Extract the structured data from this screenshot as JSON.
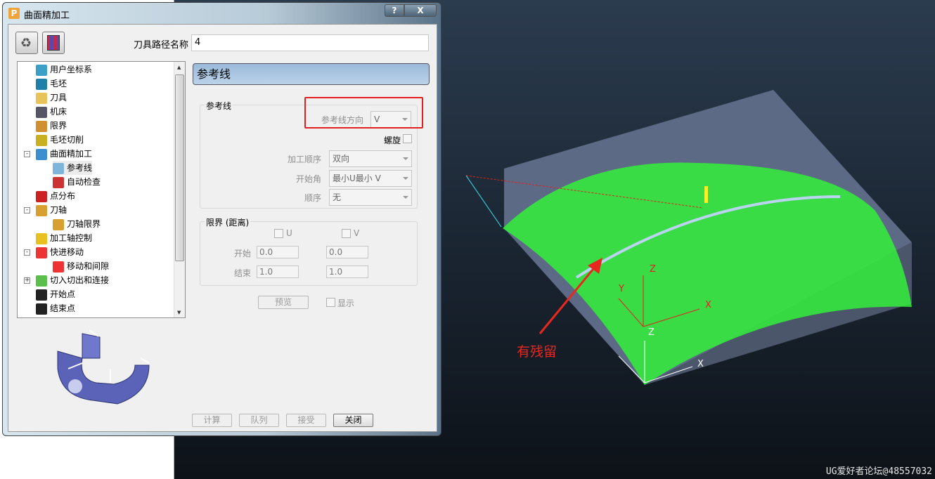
{
  "window": {
    "title": "曲面精加工",
    "help": "?",
    "close": "X",
    "app_icon": "P"
  },
  "toolbar": {
    "icons": [
      "recycle-icon",
      "toolpath-preview-icon"
    ]
  },
  "toolpath_name": {
    "label": "刀具路径名称",
    "value": "4"
  },
  "tree": {
    "items": [
      {
        "label": "用户坐标系",
        "icon": "user-coordinate-icon",
        "level": 0
      },
      {
        "label": "毛坯",
        "icon": "block-icon",
        "level": 0
      },
      {
        "label": "刀具",
        "icon": "tool-icon",
        "level": 0
      },
      {
        "label": "机床",
        "icon": "machine-icon",
        "level": 0
      },
      {
        "label": "限界",
        "icon": "limits-icon",
        "level": 0
      },
      {
        "label": "毛坯切削",
        "icon": "stock-cut-icon",
        "level": 0
      },
      {
        "label": "曲面精加工",
        "icon": "surface-finish-icon",
        "level": 0,
        "expander": "-"
      },
      {
        "label": "参考线",
        "icon": "reference-line-icon",
        "level": 1,
        "selected": true
      },
      {
        "label": "自动检查",
        "icon": "auto-check-icon",
        "level": 1
      },
      {
        "label": "点分布",
        "icon": "point-distribution-icon",
        "level": 0
      },
      {
        "label": "刀轴",
        "icon": "tool-axis-icon",
        "level": 0,
        "expander": "-"
      },
      {
        "label": "刀轴限界",
        "icon": "tool-axis-limits-icon",
        "level": 1
      },
      {
        "label": "加工轴控制",
        "icon": "axis-control-icon",
        "level": 0
      },
      {
        "label": "快进移动",
        "icon": "rapid-move-icon",
        "level": 0,
        "expander": "-"
      },
      {
        "label": "移动和间隙",
        "icon": "moves-gaps-icon",
        "level": 1
      },
      {
        "label": "切入切出和连接",
        "icon": "leads-links-icon",
        "level": 0,
        "expander": "+"
      },
      {
        "label": "开始点",
        "icon": "start-point-icon",
        "level": 0
      },
      {
        "label": "结束点",
        "icon": "end-point-icon",
        "level": 0
      }
    ]
  },
  "panel": {
    "header": "参考线",
    "ref_group": {
      "title": "参考线",
      "direction_label": "参考线方向",
      "direction_value": "V",
      "spiral_label": "螺旋",
      "order_label": "加工顺序",
      "order_value": "双向",
      "start_corner_label": "开始角",
      "start_corner_value": "最小U最小 V",
      "sequence_label": "顺序",
      "sequence_value": "无"
    },
    "limits_group": {
      "title": "限界 (距离)",
      "u_label": "U",
      "v_label": "V",
      "start_label": "开始",
      "end_label": "结束",
      "u_start": "0.0",
      "v_start": "0.0",
      "u_end": "1.0",
      "v_end": "1.0"
    },
    "preview_label": "预览",
    "display_label": "显示"
  },
  "footer": {
    "calculate": "计算",
    "queue": "队列",
    "accept": "接受",
    "close": "关闭"
  },
  "viewport": {
    "annotation": "有残留",
    "axis_labels": {
      "x": "X",
      "y": "Y",
      "z": "Z",
      "x2": "X",
      "z2": "Z"
    },
    "watermark": "UG爱好者论坛@48557032"
  },
  "colors": {
    "toolpath": "#33f03a",
    "annotation": "#e8281f",
    "header": "#a9c5e2"
  }
}
